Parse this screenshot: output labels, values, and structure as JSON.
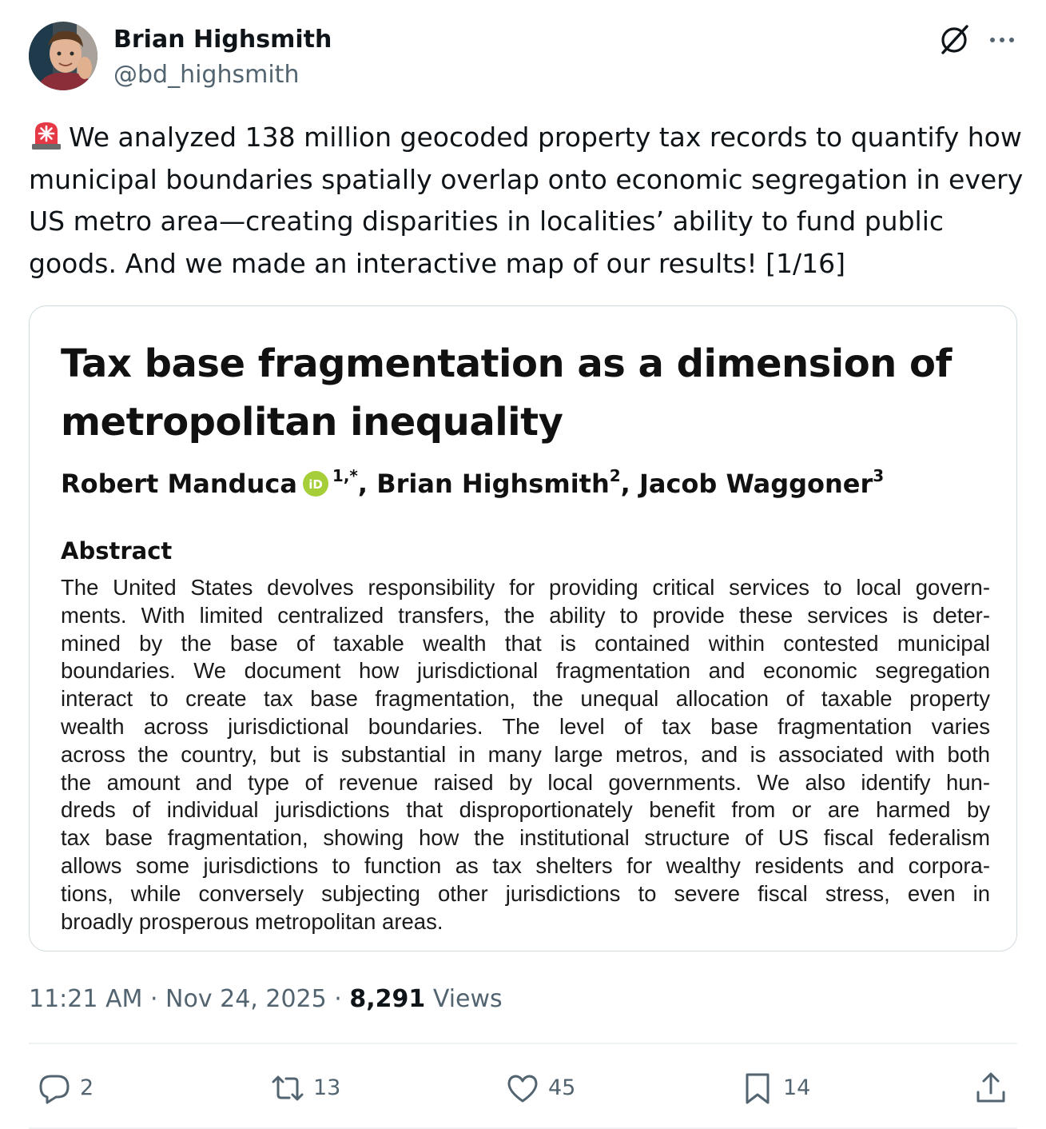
{
  "author": {
    "display_name": "Brian Highsmith",
    "handle": "@bd_highsmith"
  },
  "header_icons": [
    "grok-icon",
    "more-icon"
  ],
  "tweet": {
    "emoji": "siren-icon",
    "text": "We analyzed 138 million geocoded property tax records to quantify how municipal boundaries spatially overlap onto economic segregation in every US metro area—creating disparities in localities’ ability to fund public goods. And we made an interactive map of our results! [1/16]"
  },
  "paper": {
    "title_lines": [
      "Tax base fragmentation as a dimension of",
      "metropolitan inequality"
    ],
    "authors": [
      {
        "name": "Robert Manduca",
        "sup": "1,*"
      },
      {
        "name": "Brian Highsmith",
        "sup": "2"
      },
      {
        "name": "Jacob Waggoner",
        "sup": "3"
      }
    ],
    "author_separator": ",",
    "abstract_heading": "Abstract",
    "abstract_lines": [
      "The United States devolves responsibility for providing critical services to local govern-",
      "ments. With limited centralized transfers, the ability to provide these services is deter-",
      "mined by the base of taxable wealth that is contained within contested municipal",
      "boundaries. We document how jurisdictional fragmentation and economic segregation",
      "interact to create tax base fragmentation, the unequal allocation of taxable property",
      "wealth across jurisdictional boundaries. The level of tax base fragmentation varies",
      "across the country, but is substantial in many large metros, and is associated with both",
      "the amount and type of revenue raised by local governments. We also identify hun-",
      "dreds of individual jurisdictions that disproportionately benefit from or are harmed by",
      "tax base fragmentation, showing how the institutional structure of US fiscal federalism",
      "allows some jurisdictions to function as tax shelters for wealthy residents and corpora-",
      "tions, while conversely subjecting other jurisdictions to severe fiscal stress, even in",
      "broadly prosperous metropolitan areas."
    ]
  },
  "meta": {
    "time": "11:21 AM",
    "separator": "·",
    "date": "Nov 24, 2025",
    "views_count": "8,291",
    "views_label": "Views"
  },
  "actions": {
    "reply": {
      "icon": "reply-icon",
      "count": "2"
    },
    "repost": {
      "icon": "repost-icon",
      "count": "13"
    },
    "like": {
      "icon": "heart-icon",
      "count": "45"
    },
    "bookmark": {
      "icon": "bookmark-icon",
      "count": "14"
    },
    "share": {
      "icon": "share-icon"
    }
  },
  "colors": {
    "text_primary": "#0f1419",
    "text_secondary": "#536471",
    "border": "#cfd9de",
    "divider": "#eff3f4",
    "orcid_green": "#a6ce39",
    "siren_red": "#e53945"
  }
}
